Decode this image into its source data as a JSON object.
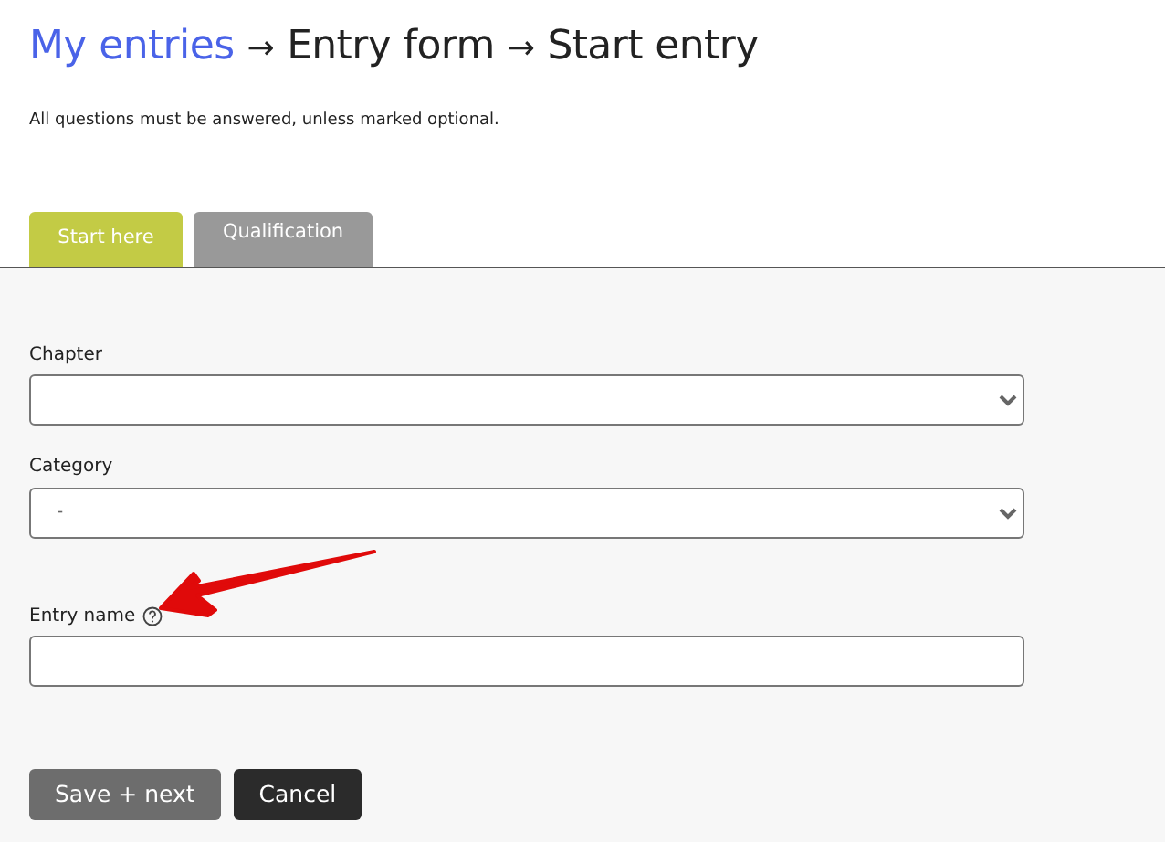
{
  "breadcrumb": [
    {
      "label": "My entries",
      "kind": "link"
    },
    {
      "label": "→",
      "kind": "separator"
    },
    {
      "label": "Entry form",
      "kind": "current"
    },
    {
      "label": "→",
      "kind": "separator"
    },
    {
      "label": "Start entry",
      "kind": "current"
    }
  ],
  "notice": "All questions must be answered, unless marked optional.",
  "tabs": [
    {
      "label": "Start here",
      "selected": true
    },
    {
      "label": "Qualification",
      "selected": false
    }
  ],
  "fields": [
    {
      "label": "Chapter",
      "kind": "select"
    },
    {
      "label": "Category",
      "kind": "select",
      "value": "-"
    },
    {
      "label": "Entry name",
      "kind": "text",
      "help": true
    }
  ],
  "buttons": [
    {
      "label": "Save + next",
      "kind": "primary"
    },
    {
      "label": "Cancel",
      "kind": "secondary"
    }
  ]
}
